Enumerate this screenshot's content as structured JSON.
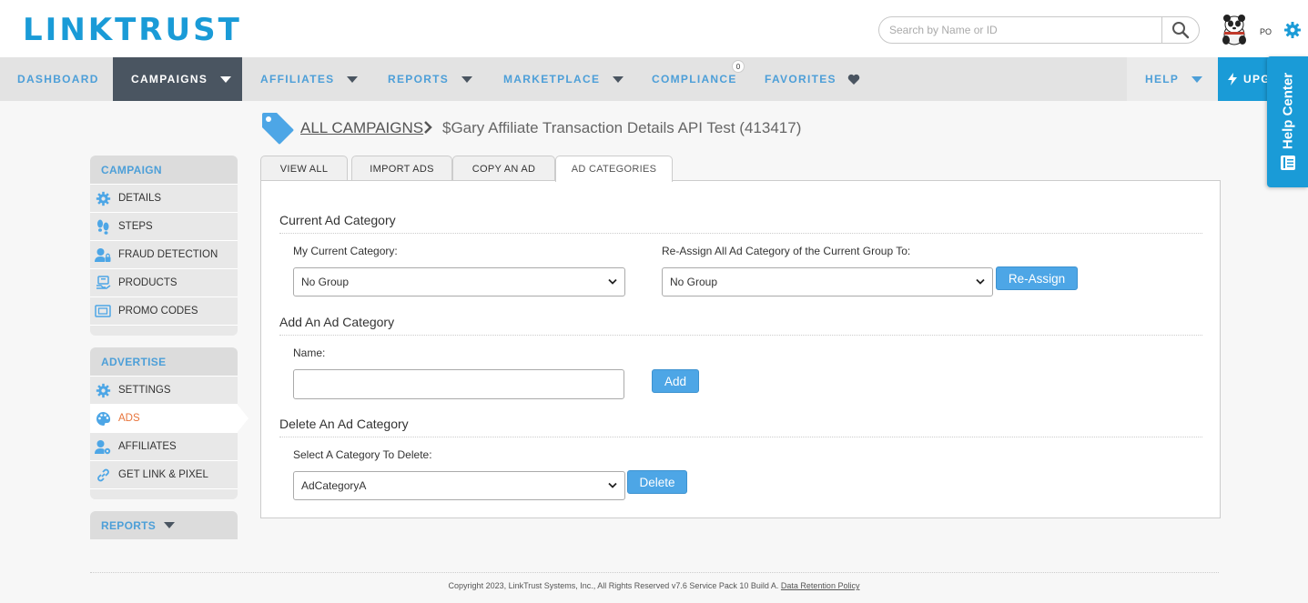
{
  "app": {
    "logo": "LINKTRUST"
  },
  "header": {
    "search_placeholder": "Search by Name or ID",
    "user_initials": "PO"
  },
  "nav": {
    "items": [
      {
        "label": "DASHBOARD"
      },
      {
        "label": "CAMPAIGNS"
      },
      {
        "label": "AFFILIATES"
      },
      {
        "label": "REPORTS"
      },
      {
        "label": "MARKETPLACE"
      },
      {
        "label": "COMPLIANCE"
      },
      {
        "label": "FAVORITES"
      }
    ],
    "compliance_badge": "0",
    "help": "HELP",
    "upgrade": "UPG"
  },
  "help_center": {
    "label": "Help Center"
  },
  "breadcrumb": {
    "root": "ALL CAMPAIGNS",
    "current": "$Gary Affiliate Transaction Details API Test (413417)"
  },
  "sidebar": {
    "campaign": {
      "header": "CAMPAIGN",
      "items": [
        {
          "label": "DETAILS",
          "icon": "gear-icon"
        },
        {
          "label": "STEPS",
          "icon": "footsteps-icon"
        },
        {
          "label": "FRAUD DETECTION",
          "icon": "user-lock-icon"
        },
        {
          "label": "PRODUCTS",
          "icon": "products-icon"
        },
        {
          "label": "PROMO CODES",
          "icon": "ticket-icon"
        }
      ]
    },
    "advertise": {
      "header": "ADVERTISE",
      "items": [
        {
          "label": "SETTINGS",
          "icon": "gear-icon"
        },
        {
          "label": "ADS",
          "icon": "palette-icon"
        },
        {
          "label": "AFFILIATES",
          "icon": "user-gear-icon"
        },
        {
          "label": "GET LINK & PIXEL",
          "icon": "link-icon"
        }
      ]
    },
    "reports": {
      "header": "REPORTS"
    }
  },
  "tabs": [
    {
      "label": "VIEW ALL"
    },
    {
      "label": "IMPORT ADS"
    },
    {
      "label": "COPY AN AD"
    },
    {
      "label": "AD CATEGORIES"
    }
  ],
  "current_category": {
    "title": "Current Ad Category",
    "my_label": "My Current Category:",
    "my_value": "No Group",
    "reassign_label": "Re-Assign All Ad Category of the Current Group To:",
    "reassign_value": "No Group",
    "reassign_button": "Re-Assign"
  },
  "add_category": {
    "title": "Add An Ad Category",
    "name_label": "Name:",
    "name_value": "",
    "add_button": "Add"
  },
  "delete_category": {
    "title": "Delete An Ad Category",
    "select_label": "Select A Category To Delete:",
    "select_value": "AdCategoryA",
    "delete_button": "Delete"
  },
  "footer": {
    "text": "Copyright 2023, LinkTrust Systems, Inc., All Rights Reserved v7.6 Service Pack 10 Build A.",
    "link": "Data Retention Policy"
  },
  "colors": {
    "brand_blue": "#1a9bd7",
    "nav_active": "#4a5561",
    "active_orange": "#e8743b",
    "button_blue": "#4da6e6"
  }
}
